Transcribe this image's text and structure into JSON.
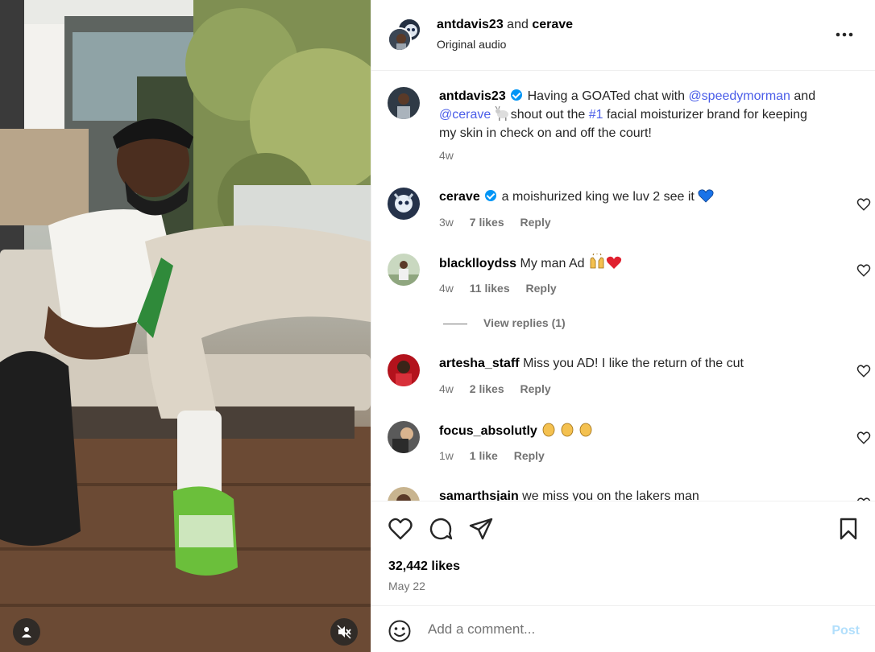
{
  "media": {
    "tag_icon": "person-icon",
    "mute_icon": "speaker-muted-icon"
  },
  "header": {
    "user1": "antdavis23",
    "joiner": "and",
    "user2": "cerave",
    "subtitle": "Original audio",
    "more_icon": "more-horizontal-icon"
  },
  "caption": {
    "username": "antdavis23",
    "text_1": "Having a GOATed chat with",
    "mention_1": "@speedymorman",
    "text_2": "and",
    "mention_2": "@cerave",
    "emoji": "goat",
    "text_3": "shout out the",
    "hashtag": "#1",
    "text_4": "facial moisturizer brand for keeping my skin in check on and off the court!",
    "time": "4w"
  },
  "comments": [
    {
      "username": "cerave",
      "verified": true,
      "text": "a moishurized king we luv 2 see it",
      "emoji": "blue-heart",
      "time": "3w",
      "likes": "7 likes",
      "reply": "Reply"
    },
    {
      "username": "blacklloydss",
      "text": "My man Ad",
      "emoji": "raised-hands red-heart",
      "time": "4w",
      "likes": "11 likes",
      "reply": "Reply",
      "view_replies": "View replies (1)"
    },
    {
      "username": "artesha_staff",
      "text": "Miss you AD! I like the return of the cut",
      "time": "4w",
      "likes": "2 likes",
      "reply": "Reply"
    },
    {
      "username": "focus_absolutly",
      "text": "",
      "emoji": "clapping-hands x3",
      "time": "1w",
      "likes": "1 like",
      "reply": "Reply"
    },
    {
      "username": "samarthsjain",
      "text": "we miss you on the lakers man"
    }
  ],
  "actions": {
    "likes": "32,442 likes",
    "date": "May 22"
  },
  "comment_box": {
    "placeholder": "Add a comment...",
    "post_label": "Post"
  },
  "colors": {
    "mention": "#4a5de8",
    "verified": "#0095f6",
    "post_disabled": "#b2dffc",
    "muted_text": "#737373"
  }
}
